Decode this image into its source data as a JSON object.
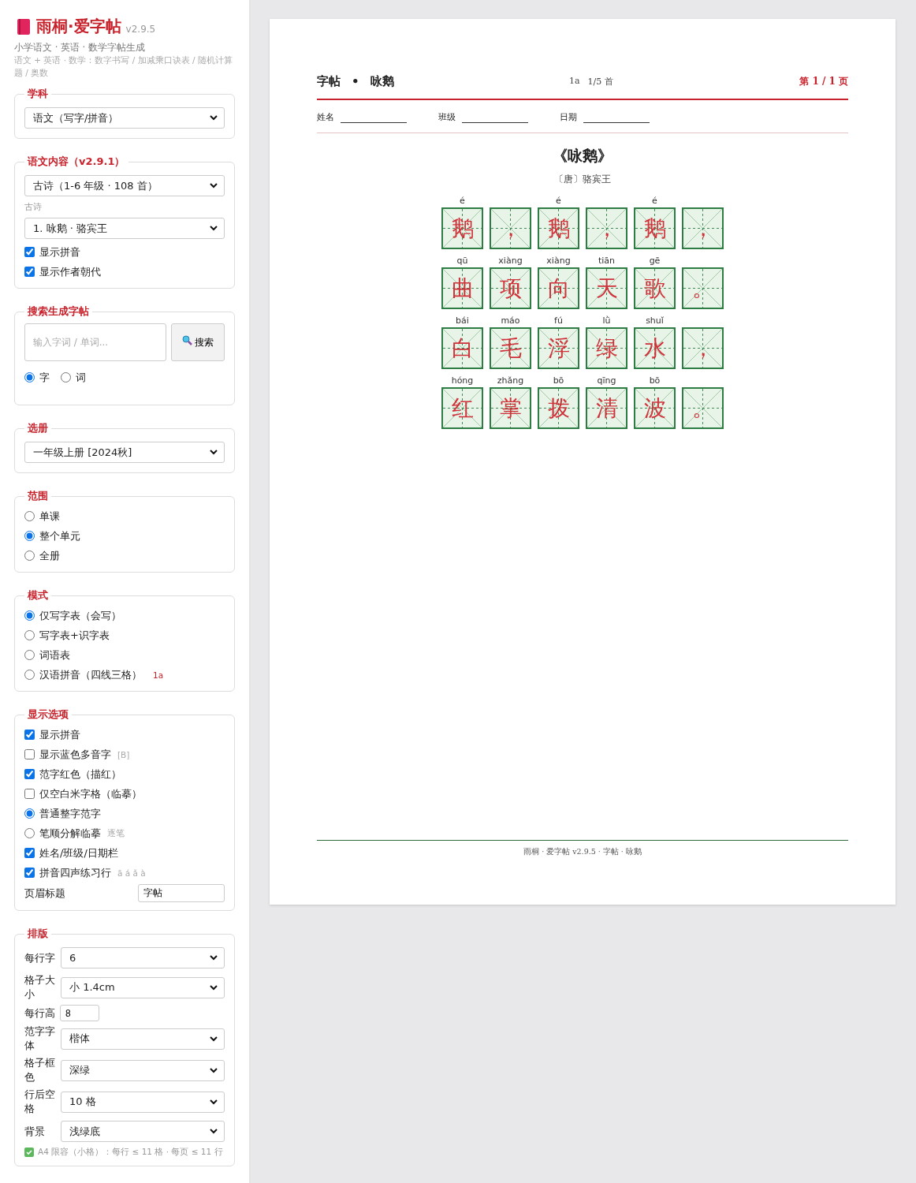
{
  "app": {
    "title": "雨桐·爱字帖",
    "version": "v2.9.5",
    "subtitle": "小学语文 · 英语 · 数学字帖生成",
    "description": "语文 + 英语 · 数学：数字书写 / 加减乘口诀表 / 随机计算题 / 奥数"
  },
  "sections": [
    {
      "legend": "学科",
      "fields": [
        {
          "kind": "select",
          "value": "语文（写字/拼音）"
        }
      ]
    },
    {
      "legend": "语文内容（v2.9.1）",
      "fields": [
        {
          "kind": "select",
          "value": "古诗（1-6 年级 · 108 首）"
        },
        {
          "kind": "caption",
          "text": "古诗"
        },
        {
          "kind": "select",
          "value": "1. 咏鹅 · 骆宾王"
        },
        {
          "kind": "checkbox",
          "label": "显示拼音",
          "checked": true
        },
        {
          "kind": "checkbox",
          "label": "显示作者朝代",
          "checked": true
        }
      ]
    },
    {
      "legend": "搜索生成字帖",
      "fields": [
        {
          "kind": "search",
          "placeholder": "输入字词 / 单词...",
          "button": "搜索"
        },
        {
          "kind": "radio_row",
          "options": [
            {
              "label": "字",
              "selected": true
            },
            {
              "label": "词",
              "selected": false
            }
          ]
        }
      ]
    },
    {
      "legend": "选册",
      "fields": [
        {
          "kind": "select",
          "value": "一年级上册 [2024秋]"
        }
      ]
    },
    {
      "legend": "范围",
      "fields": [
        {
          "kind": "radio",
          "label": "单课",
          "selected": false
        },
        {
          "kind": "radio",
          "label": "整个单元",
          "selected": true
        },
        {
          "kind": "radio",
          "label": "全册",
          "selected": false
        }
      ]
    },
    {
      "legend": "模式",
      "fields": [
        {
          "kind": "radio",
          "label": "仅写字表（会写）",
          "selected": true
        },
        {
          "kind": "radio",
          "label": "写字表+识字表",
          "selected": false
        },
        {
          "kind": "radio",
          "label": "词语表",
          "selected": false
        },
        {
          "kind": "radio",
          "label": "汉语拼音（四线三格）",
          "selected": false,
          "badge": "1a"
        }
      ]
    },
    {
      "legend": "显示选项",
      "fields": [
        {
          "kind": "checkbox",
          "label": "显示拼音",
          "checked": true
        },
        {
          "kind": "checkbox",
          "label": "显示蓝色多音字",
          "checked": false,
          "hint": "[B]"
        },
        {
          "kind": "checkbox",
          "label": "范字红色（描红）",
          "checked": true
        },
        {
          "kind": "checkbox",
          "label": "仅空白米字格（临摹）",
          "checked": false
        },
        {
          "kind": "radio",
          "label": "普通整字范字",
          "selected": true
        },
        {
          "kind": "radio",
          "label": "笔顺分解临摹",
          "selected": false,
          "hint": "逐笔"
        },
        {
          "kind": "checkbox",
          "label": "姓名/班级/日期栏",
          "checked": true
        },
        {
          "kind": "checkbox",
          "label": "拼音四声练习行",
          "checked": true,
          "hint": "ā á ǎ à"
        },
        {
          "kind": "text_input",
          "label": "页眉标题",
          "value": "字帖"
        }
      ]
    },
    {
      "legend": "排版",
      "fields": [
        {
          "kind": "labeled_select",
          "label": "每行字",
          "value": "6"
        },
        {
          "kind": "labeled_select",
          "label": "格子大小",
          "value": "小 1.4cm"
        },
        {
          "kind": "labeled_input",
          "label": "每行高",
          "value": "8"
        },
        {
          "kind": "labeled_select",
          "label": "范字字体",
          "value": "楷体"
        },
        {
          "kind": "labeled_select",
          "label": "格子框色",
          "value": "深绿"
        },
        {
          "kind": "labeled_select",
          "label": "行后空格",
          "value": "10 格"
        },
        {
          "kind": "labeled_select",
          "label": "背景",
          "value": "浅绿底"
        },
        {
          "kind": "note",
          "text": "A4 限容（小格）：每行 ≤ 11 格 · 每页 ≤ 11 行"
        }
      ]
    }
  ],
  "sheet": {
    "title": "字帖",
    "separator": "•",
    "poem": "咏鹅",
    "level": "1a",
    "progress": "1/5 首",
    "page": "第 1 / 1 页",
    "fields": [
      "姓名",
      "班级",
      "日期"
    ],
    "poem_title": "《咏鹅》",
    "author": "〔唐〕骆宾王",
    "rows": [
      [
        {
          "pinyin": "é",
          "char": "鹅"
        },
        {
          "char": "，"
        },
        {
          "pinyin": "é",
          "char": "鹅"
        },
        {
          "char": "，"
        },
        {
          "pinyin": "é",
          "char": "鹅"
        },
        {
          "char": "，"
        }
      ],
      [
        {
          "pinyin": "qū",
          "char": "曲"
        },
        {
          "pinyin": "xiàng",
          "char": "项"
        },
        {
          "pinyin": "xiàng",
          "char": "向"
        },
        {
          "pinyin": "tiān",
          "char": "天"
        },
        {
          "pinyin": "gē",
          "char": "歌"
        },
        {
          "char": "。"
        }
      ],
      [
        {
          "pinyin": "bái",
          "char": "白"
        },
        {
          "pinyin": "máo",
          "char": "毛"
        },
        {
          "pinyin": "fú",
          "char": "浮"
        },
        {
          "pinyin": "lǜ",
          "char": "绿"
        },
        {
          "pinyin": "shuǐ",
          "char": "水"
        },
        {
          "char": "，"
        }
      ],
      [
        {
          "pinyin": "hóng",
          "char": "红"
        },
        {
          "pinyin": "zhǎng",
          "char": "掌"
        },
        {
          "pinyin": "bō",
          "char": "拨"
        },
        {
          "pinyin": "qīng",
          "char": "清"
        },
        {
          "pinyin": "bō",
          "char": "波"
        },
        {
          "char": "。"
        }
      ]
    ],
    "footer": "雨桐 · 爱字帖 v2.9.5 · 字帖 · 咏鹅"
  }
}
